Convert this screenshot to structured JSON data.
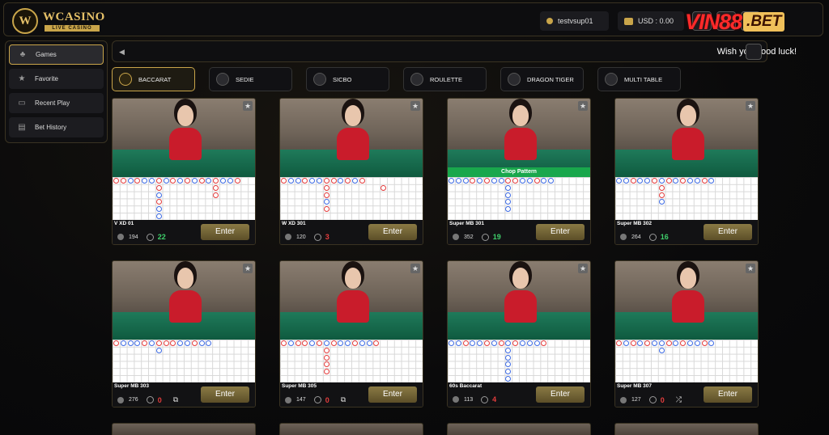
{
  "header": {
    "logo_letter": "W",
    "logo_title": "WCASINO",
    "logo_sub": "LIVE CASINO",
    "username": "testvsup01",
    "balance": "USD : 0.00",
    "brand_part1": "VIN88",
    "brand_part2": ".BET"
  },
  "sidebar": {
    "items": [
      {
        "label": "Games",
        "icon": "club-icon",
        "active": true
      },
      {
        "label": "Favorite",
        "icon": "star-icon",
        "active": false
      },
      {
        "label": "Recent Play",
        "icon": "monitor-icon",
        "active": false
      },
      {
        "label": "Bet History",
        "icon": "history-icon",
        "active": false
      }
    ]
  },
  "marquee": {
    "message": "Wish you good luck!"
  },
  "tabs": [
    {
      "label": "BACCARAT",
      "active": true
    },
    {
      "label": "SEDIE",
      "active": false
    },
    {
      "label": "SICBO",
      "active": false
    },
    {
      "label": "ROULETTE",
      "active": false
    },
    {
      "label": "DRAGON TIGER",
      "active": false
    },
    {
      "label": "MULTI TABLE",
      "active": false
    }
  ],
  "cards": [
    {
      "name": "V XD 01",
      "players": "194",
      "timer": "22",
      "timer_color": "#3fd06b",
      "extra": "",
      "strip": ""
    },
    {
      "name": "W XD 301",
      "players": "120",
      "timer": "3",
      "timer_color": "#e53d3d",
      "extra": "",
      "strip": ""
    },
    {
      "name": "Super MB 301",
      "players": "352",
      "timer": "19",
      "timer_color": "#3fd06b",
      "extra": "",
      "strip": "Chop Pattern"
    },
    {
      "name": "Super MB 302",
      "players": "264",
      "timer": "16",
      "timer_color": "#3fd06b",
      "extra": "",
      "strip": ""
    },
    {
      "name": "Super MB 303",
      "players": "276",
      "timer": "0",
      "timer_color": "#e53d3d",
      "extra": "⧉",
      "strip": ""
    },
    {
      "name": "Super MB 305",
      "players": "147",
      "timer": "0",
      "timer_color": "#e53d3d",
      "extra": "⧉",
      "strip": ""
    },
    {
      "name": "60s Baccarat",
      "players": "113",
      "timer": "4",
      "timer_color": "#e53d3d",
      "extra": "",
      "strip": ""
    },
    {
      "name": "Super MB 307",
      "players": "127",
      "timer": "0",
      "timer_color": "#e53d3d",
      "extra": "⤮",
      "strip": ""
    }
  ],
  "enter_label": "Enter",
  "colors": {
    "accent": "#c9a54a",
    "banker": "#e53d3d",
    "player": "#3d6be5",
    "timer_ok": "#3fd06b"
  }
}
